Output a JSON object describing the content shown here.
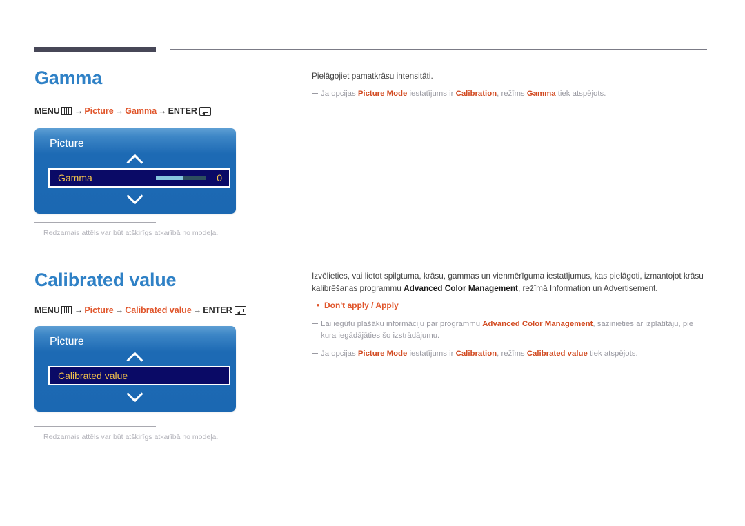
{
  "page": {
    "language": "lv",
    "accent_blue": "#2f81c6",
    "accent_orange": "#e0552b",
    "osd_gold": "#f2c14b",
    "osd_blue": "#1b68b2",
    "osd_row_navy": "#0a0a66"
  },
  "sections": [
    {
      "id": "gamma",
      "title": "Gamma",
      "menu_path": {
        "menu_label": "MENU",
        "menu_icon": "menu-icon",
        "arrow": "→",
        "steps": [
          "Picture",
          "Gamma"
        ],
        "enter_label": "ENTER",
        "enter_icon": "enter-icon"
      },
      "osd": {
        "title": "Picture",
        "up_icon": "chevron-up-icon",
        "down_icon": "chevron-down-icon",
        "row": {
          "label": "Gamma",
          "has_slider": true,
          "slider_percent": 56,
          "value": "0"
        }
      },
      "footnote": "Redzamais attēls var būt atšķirīgs atkarībā no modeļa.",
      "description": "Pielāgojiet pamatkrāsu intensitāti.",
      "notes": [
        {
          "parts": [
            {
              "text": "Ja opcijas ",
              "bold": false
            },
            {
              "text": "Picture Mode",
              "bold": true
            },
            {
              "text": " iestatījums ir ",
              "bold": false
            },
            {
              "text": "Calibration",
              "bold": true
            },
            {
              "text": ", režīms ",
              "bold": false
            },
            {
              "text": "Gamma",
              "bold": true
            },
            {
              "text": " tiek atspējots.",
              "bold": false
            }
          ]
        }
      ]
    },
    {
      "id": "calibrated-value",
      "title": "Calibrated value",
      "menu_path": {
        "menu_label": "MENU",
        "menu_icon": "menu-icon",
        "arrow": "→",
        "steps": [
          "Picture",
          "Calibrated value"
        ],
        "enter_label": "ENTER",
        "enter_icon": "enter-icon"
      },
      "osd": {
        "title": "Picture",
        "up_icon": "chevron-up-icon",
        "down_icon": "chevron-down-icon",
        "row": {
          "label": "Calibrated value",
          "has_slider": false,
          "slider_percent": 0,
          "value": ""
        }
      },
      "footnote": "Redzamais attēls var būt atšķirīgs atkarībā no modeļa.",
      "description_parts": [
        {
          "text": "Izvēlieties, vai lietot spilgtuma, krāsu, gammas un vienmērīguma iestatījumus, kas pielāgoti, izmantojot krāsu kalibrēšanas programmu ",
          "bold": false
        },
        {
          "text": "Advanced Color Management",
          "bold": true
        },
        {
          "text": ", režīmā Information un Advertisement.",
          "bold": false
        }
      ],
      "bullet": {
        "dot": "•",
        "text": "Don't apply / Apply"
      },
      "notes": [
        {
          "parts": [
            {
              "text": "Lai iegūtu plašāku informāciju par programmu ",
              "bold": false
            },
            {
              "text": "Advanced Color Management",
              "bold": true
            },
            {
              "text": ", sazinieties ar izplatītāju, pie kura iegādājāties šo izstrādājumu.",
              "bold": false
            }
          ]
        },
        {
          "parts": [
            {
              "text": "Ja opcijas ",
              "bold": false
            },
            {
              "text": "Picture Mode",
              "bold": true
            },
            {
              "text": " iestatījums ir ",
              "bold": false
            },
            {
              "text": "Calibration",
              "bold": true
            },
            {
              "text": ", režīms ",
              "bold": false
            },
            {
              "text": "Calibrated value",
              "bold": true
            },
            {
              "text": " tiek atspējots.",
              "bold": false
            }
          ]
        }
      ]
    }
  ]
}
